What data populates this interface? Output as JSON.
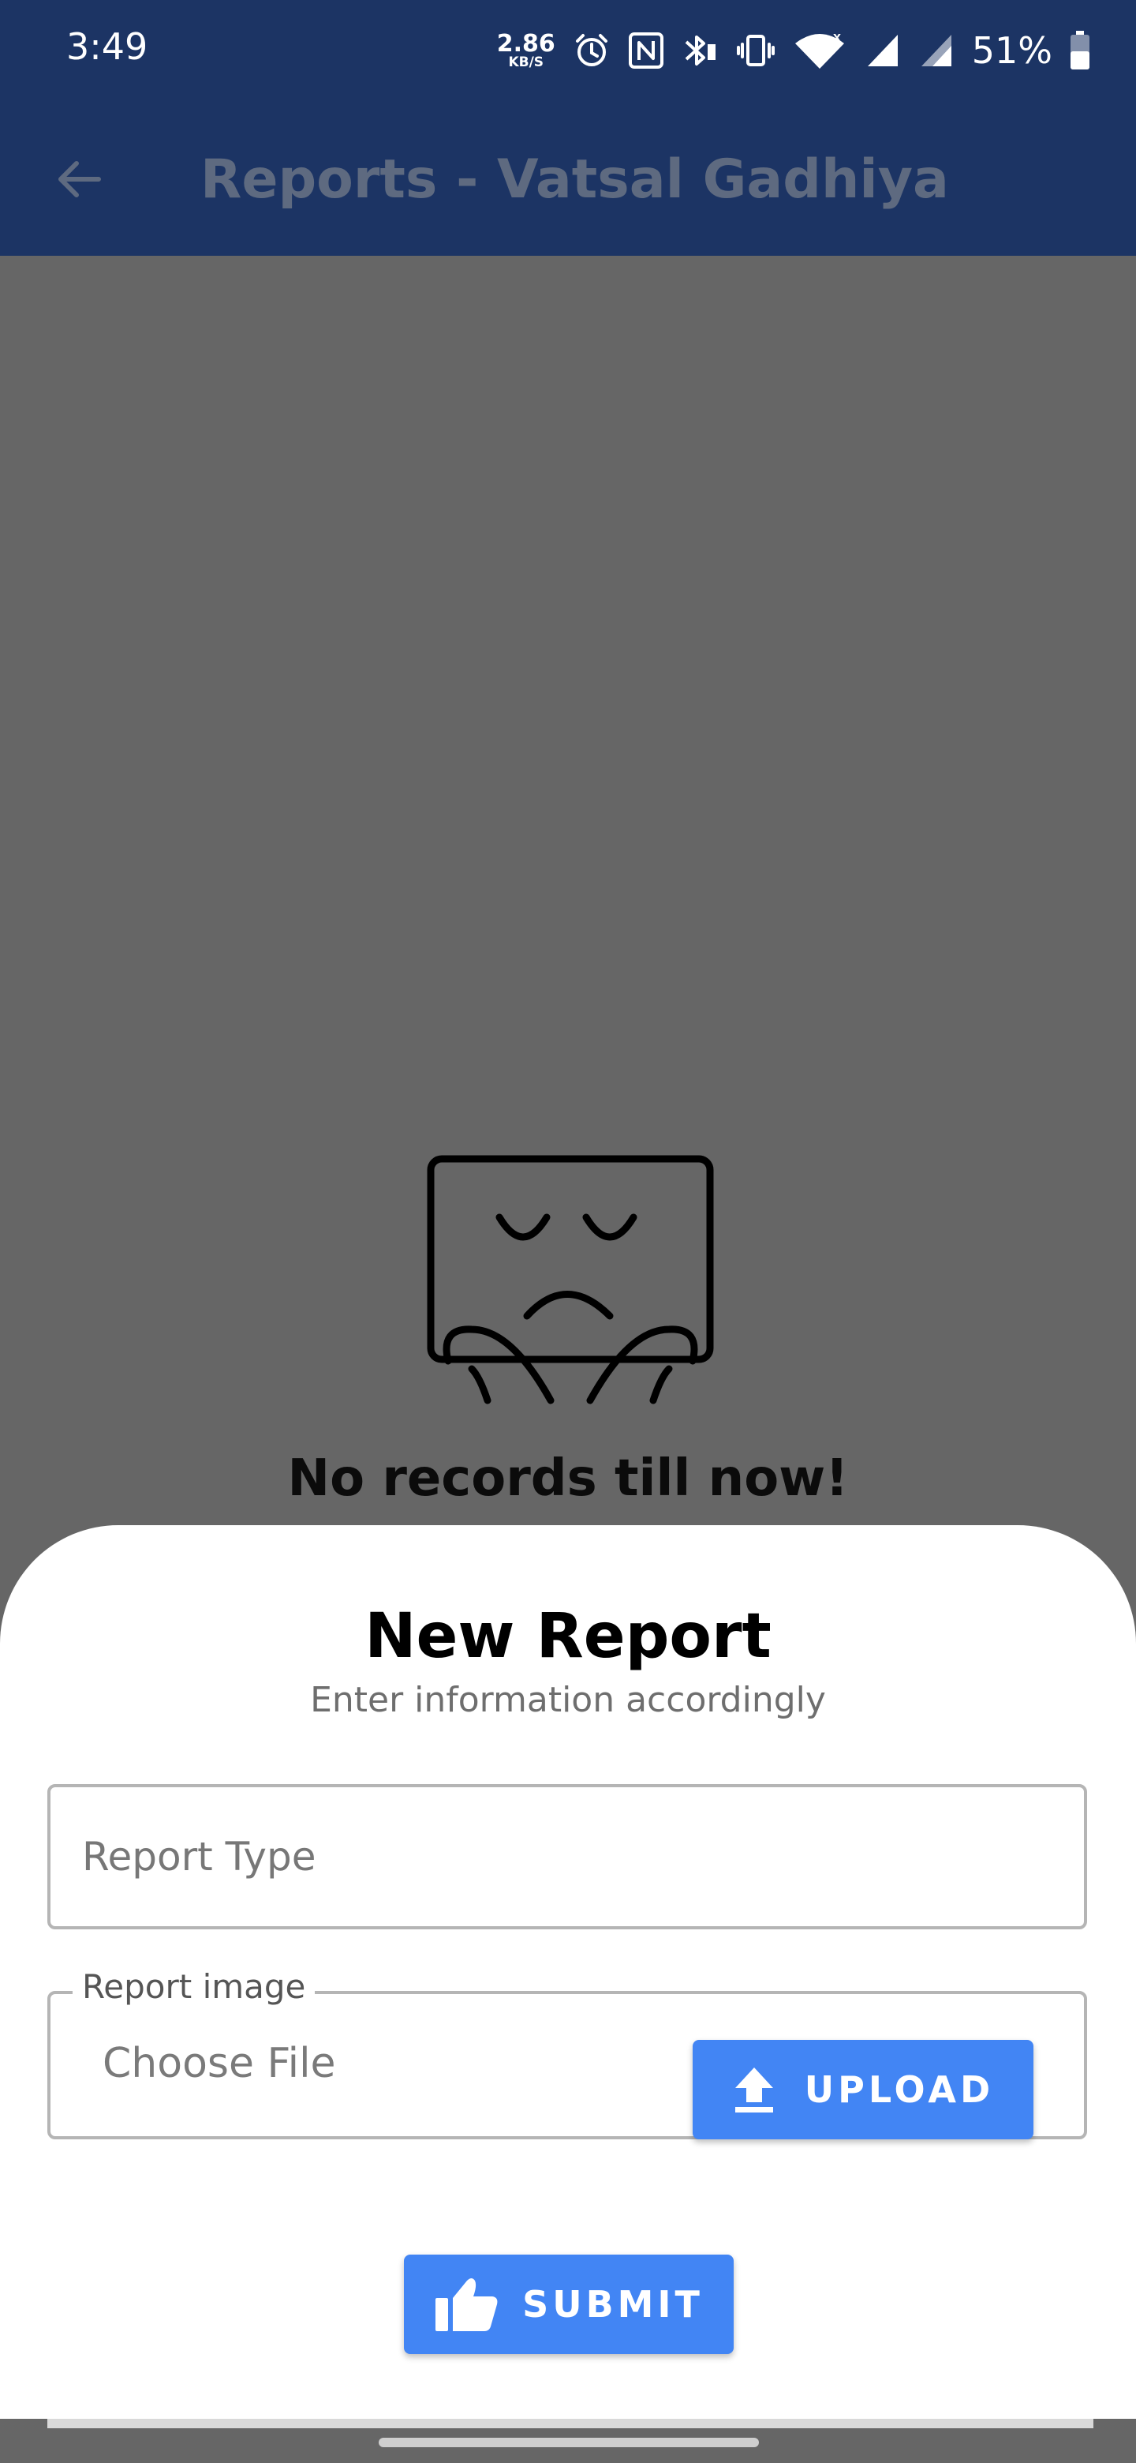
{
  "status_bar": {
    "time": "3:49",
    "net_speed_value": "2.86",
    "net_speed_unit": "KB/S",
    "battery_percent": "51%",
    "icons": [
      "alarm-icon",
      "nfc-icon",
      "bluetooth-icon",
      "vibrate-icon",
      "wifi-icon",
      "signal-icon",
      "signal-icon",
      "battery-icon"
    ]
  },
  "app_bar": {
    "title": "Reports - Vatsal Gadhiya",
    "back_icon": "arrow-back-icon",
    "background_color": "#1c3464"
  },
  "empty_state": {
    "illustration": "sad-box-icon",
    "message": "No records till now!"
  },
  "sheet": {
    "title": "New Report",
    "subtitle": "Enter information accordingly",
    "report_type": {
      "placeholder": "Report Type",
      "value": ""
    },
    "report_image": {
      "legend": "Report image",
      "file_label": "Choose File",
      "upload_label": "UPLOAD",
      "upload_icon": "upload-icon"
    },
    "submit_label": "SUBMIT",
    "submit_icon": "thumbs-up-icon",
    "accent_color": "#4285f4"
  }
}
